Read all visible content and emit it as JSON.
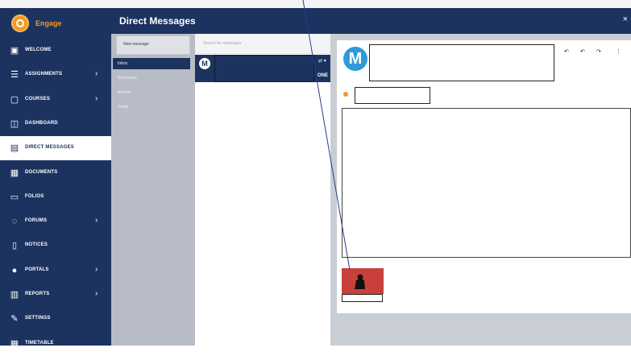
{
  "brand": {
    "name": "Engage",
    "logo_color": "#f29a23",
    "nav_color": "#1c3360"
  },
  "nav": [
    {
      "label": "WELCOME",
      "icon": "briefcase-icon",
      "chevron": false,
      "active": false
    },
    {
      "label": "ASSIGNMENTS",
      "icon": "checklist-icon",
      "chevron": true,
      "active": false
    },
    {
      "label": "COURSES",
      "icon": "chat-board-icon",
      "chevron": true,
      "active": false
    },
    {
      "label": "DASHBOARD",
      "icon": "dashboard-icon",
      "chevron": false,
      "active": false
    },
    {
      "label": "DIRECT MESSAGES",
      "icon": "inbox-icon",
      "chevron": false,
      "active": true
    },
    {
      "label": "DOCUMENTS",
      "icon": "documents-icon",
      "chevron": false,
      "active": false
    },
    {
      "label": "FOLIOS",
      "icon": "folder-icon",
      "chevron": false,
      "active": false
    },
    {
      "label": "FORUMS",
      "icon": "forum-icon",
      "chevron": true,
      "active": false
    },
    {
      "label": "NOTICES",
      "icon": "notice-icon",
      "chevron": false,
      "active": false
    },
    {
      "label": "PORTALS",
      "icon": "portal-icon",
      "chevron": true,
      "active": false
    },
    {
      "label": "REPORTS",
      "icon": "report-icon",
      "chevron": true,
      "active": false
    },
    {
      "label": "SETTINGS",
      "icon": "wrench-icon",
      "chevron": false,
      "active": false
    },
    {
      "label": "TIMETABLE",
      "icon": "calendar-icon",
      "chevron": false,
      "active": false
    }
  ],
  "header": {
    "title": "Direct Messages",
    "close": "×"
  },
  "messages_panel": {
    "new_message_label": "New message",
    "folders": [
      {
        "label": "Inbox",
        "selected": true
      },
      {
        "label": "Sent Items",
        "selected": false
      },
      {
        "label": "Archive",
        "selected": false
      },
      {
        "label": "Drafts",
        "selected": false
      }
    ],
    "search_placeholder": "Search for messages"
  },
  "message_list": [
    {
      "avatar_letter": "M",
      "tag": "ONE",
      "icons": "⇄ ▾"
    }
  ],
  "reader": {
    "avatar_letter": "M",
    "avatar_color": "#2e9bd8",
    "actions": [
      "reply-icon",
      "reply-all-icon",
      "forward-icon",
      "more-icon"
    ],
    "action_glyphs": [
      "↶",
      "↶",
      "↷",
      "⋮"
    ]
  },
  "attachment": {
    "color": "#c9403b"
  }
}
